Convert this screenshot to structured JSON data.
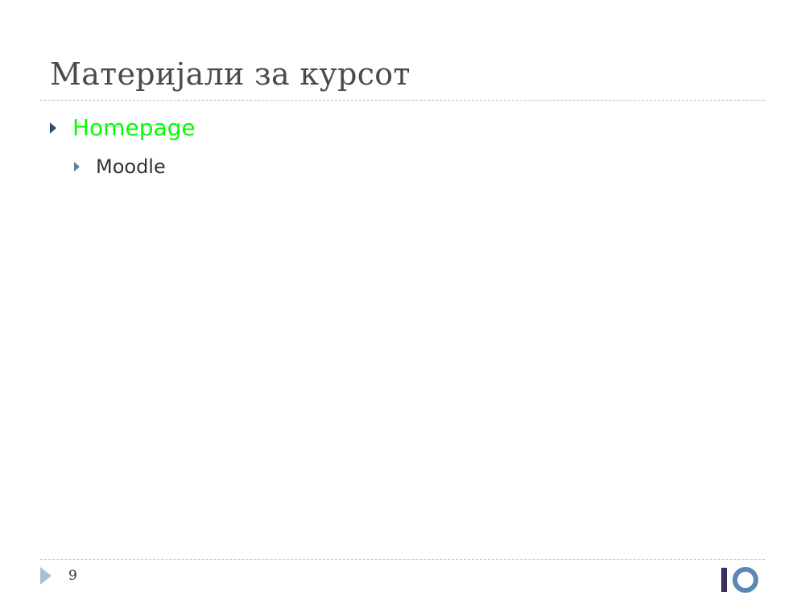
{
  "slide": {
    "title": "Материјали за курсот",
    "bullets": [
      {
        "text": "Homepage",
        "color": "#00ff00",
        "children": [
          {
            "text": "Moodle"
          }
        ]
      }
    ],
    "page_number": "9",
    "logo": "io-logo"
  },
  "colors": {
    "title": "#4a4a4a",
    "rule": "#a9c0d2",
    "bullet_marker": "#2f4f6f",
    "link": "#00ff00",
    "logo_bar": "#3b2f5e",
    "logo_ring": "#5b86b6"
  }
}
